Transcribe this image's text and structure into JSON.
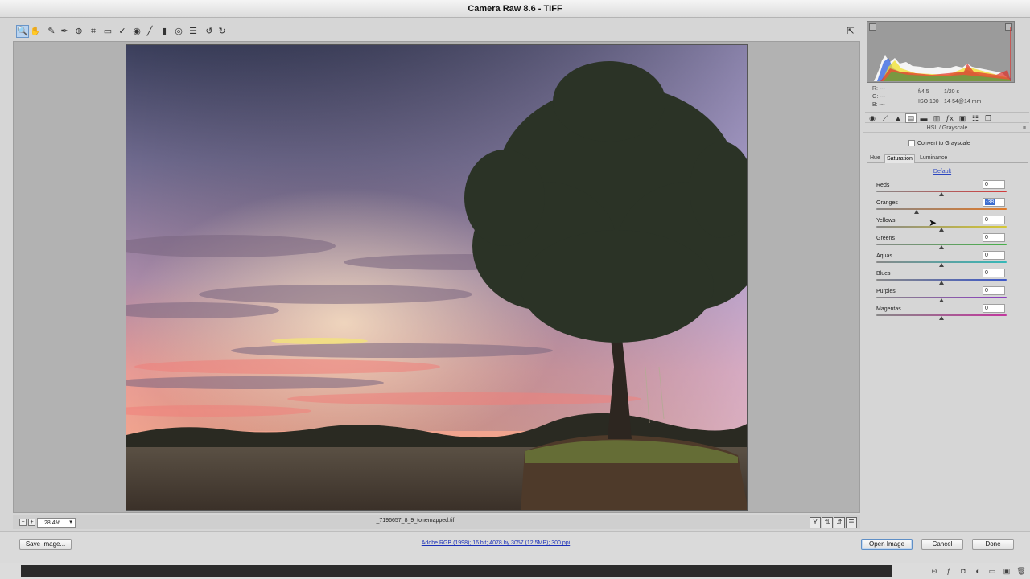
{
  "window": {
    "title": "Camera Raw 8.6  -  TIFF"
  },
  "toolbar": {
    "tools": [
      {
        "name": "zoom-tool",
        "glyph": "🔍",
        "active": true
      },
      {
        "name": "hand-tool",
        "glyph": "✋",
        "active": false
      },
      {
        "name": "white-balance-tool",
        "glyph": "✎",
        "active": false
      },
      {
        "name": "color-sampler-tool",
        "glyph": "✒",
        "active": false
      },
      {
        "name": "targeted-adjustment-tool",
        "glyph": "⊕",
        "active": false
      },
      {
        "name": "crop-tool",
        "glyph": "⌗",
        "active": false
      },
      {
        "name": "straighten-tool",
        "glyph": "▭",
        "active": false
      },
      {
        "name": "spot-removal-tool",
        "glyph": "✓",
        "active": false
      },
      {
        "name": "red-eye-tool",
        "glyph": "◉",
        "active": false
      },
      {
        "name": "adjustment-brush-tool",
        "glyph": "╱",
        "active": false
      },
      {
        "name": "graduated-filter-tool",
        "glyph": "▮",
        "active": false
      },
      {
        "name": "radial-filter-tool",
        "glyph": "◎",
        "active": false
      },
      {
        "name": "preferences-tool",
        "glyph": "☰",
        "active": false
      },
      {
        "name": "rotate-left-tool",
        "glyph": "↺",
        "active": false
      },
      {
        "name": "rotate-right-tool",
        "glyph": "↻",
        "active": false
      }
    ],
    "fullscreen_glyph": "⇱"
  },
  "status": {
    "zoom": "28.4%",
    "filename": "_7196657_8_9_tonemapped.tif",
    "zoom_out": "−",
    "zoom_in": "+"
  },
  "bottom": {
    "save_image": "Save Image...",
    "workflow": "Adobe RGB (1998); 16 bit; 4078 by 3057 (12.5MP); 300 ppi",
    "open_image": "Open Image",
    "cancel": "Cancel",
    "done": "Done"
  },
  "readout": {
    "r": "R:   ---",
    "g": "G:   ---",
    "b": "B:   ---",
    "aperture": "f/4.5",
    "shutter": "1/20 s",
    "iso": "ISO 100",
    "lens": "14-54@14 mm"
  },
  "panel": {
    "title": "HSL / Grayscale",
    "convert_grayscale": "Convert to Grayscale",
    "tabs": [
      "Hue",
      "Saturation",
      "Luminance"
    ],
    "active_tab": "Saturation",
    "default_link": "Default",
    "sliders": [
      {
        "label": "Reds",
        "value": "0",
        "fraction": 0.5,
        "gradient": "linear-gradient(90deg,#888,#d23b3b)"
      },
      {
        "label": "Oranges",
        "value": "-38",
        "fraction": 0.31,
        "gradient": "linear-gradient(90deg,#888,#e07a2a)",
        "selected": true
      },
      {
        "label": "Yellows",
        "value": "0",
        "fraction": 0.5,
        "gradient": "linear-gradient(90deg,#888,#d6c834)"
      },
      {
        "label": "Greens",
        "value": "0",
        "fraction": 0.5,
        "gradient": "linear-gradient(90deg,#888,#46b048)"
      },
      {
        "label": "Aquas",
        "value": "0",
        "fraction": 0.5,
        "gradient": "linear-gradient(90deg,#888,#36b8b8)"
      },
      {
        "label": "Blues",
        "value": "0",
        "fraction": 0.5,
        "gradient": "linear-gradient(90deg,#888,#3d58c8)"
      },
      {
        "label": "Purples",
        "value": "0",
        "fraction": 0.5,
        "gradient": "linear-gradient(90deg,#888,#8b3cc0)"
      },
      {
        "label": "Magentas",
        "value": "0",
        "fraction": 0.5,
        "gradient": "linear-gradient(90deg,#888,#c2379e)"
      }
    ]
  }
}
